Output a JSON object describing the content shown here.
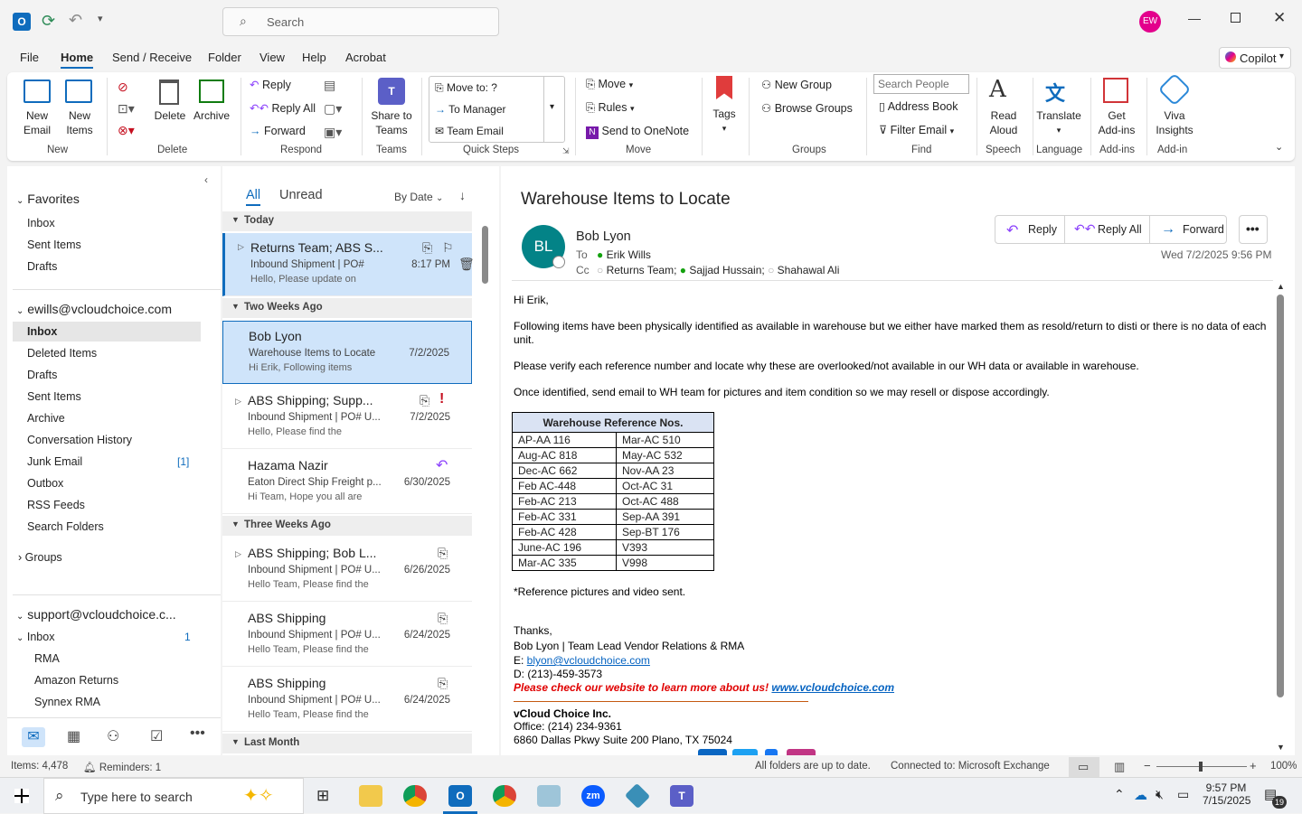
{
  "titlebar": {
    "search_placeholder": "Search",
    "avatar_initials": "EW"
  },
  "menu": {
    "items": [
      "File",
      "Home",
      "Send / Receive",
      "Folder",
      "View",
      "Help",
      "Acrobat"
    ],
    "active": "Home",
    "copilot": "Copilot"
  },
  "ribbon": {
    "new_email": [
      "New",
      "Email"
    ],
    "new_items": [
      "New",
      "Items"
    ],
    "delete": "Delete",
    "archive": "Archive",
    "reply": "Reply",
    "reply_all": "Reply All",
    "forward": "Forward",
    "share_teams": [
      "Share to",
      "Teams"
    ],
    "qs_move_to": "Move to: ?",
    "qs_to_manager": "To Manager",
    "qs_team_email": "Team Email",
    "move": "Move",
    "rules": "Rules",
    "send_onenote": "Send to OneNote",
    "tags": "Tags",
    "new_group": "New Group",
    "browse_groups": "Browse Groups",
    "search_people": "Search People",
    "address_book": "Address Book",
    "filter_email": "Filter Email",
    "read_aloud": [
      "Read",
      "Aloud"
    ],
    "translate": "Translate",
    "get_addins": [
      "Get",
      "Add-ins"
    ],
    "viva": [
      "Viva",
      "Insights"
    ],
    "groups": [
      "New",
      "Delete",
      "Respond",
      "Teams",
      "Quick Steps",
      "Move",
      "Groups",
      "Find",
      "Speech",
      "Language",
      "Add-ins",
      "Add-in"
    ]
  },
  "nav": {
    "favorites": "Favorites",
    "fav_items": [
      "Inbox",
      "Sent Items",
      "Drafts"
    ],
    "account1": "ewills@vcloudchoice.com",
    "acc1_items": [
      "Inbox",
      "Deleted Items",
      "Drafts",
      "Sent Items",
      "Archive",
      "Conversation History",
      "Junk Email",
      "Outbox",
      "RSS Feeds",
      "Search Folders"
    ],
    "junk_count": "[1]",
    "groups": "Groups",
    "account2": "support@vcloudchoice.c...",
    "acc2_inbox": "Inbox",
    "acc2_inbox_count": "1",
    "acc2_sub": [
      "RMA",
      "Amazon Returns",
      "Synnex RMA"
    ]
  },
  "list": {
    "tab_all": "All",
    "tab_unread": "Unread",
    "sort": "By Date",
    "groups": [
      "Today",
      "Two Weeks Ago",
      "Three Weeks Ago",
      "Last Month"
    ],
    "items": [
      {
        "sender": "Returns Team;  ABS S...",
        "subject": "Inbound Shipment | PO#",
        "preview": "Hello,  Please update on",
        "date": "8:17 PM"
      },
      {
        "sender": "Bob Lyon",
        "subject": "Warehouse Items to Locate",
        "preview": "Hi Erik,  Following items",
        "date": "7/2/2025"
      },
      {
        "sender": "ABS Shipping;  Supp...",
        "subject": "Inbound Shipment | PO# U...",
        "preview": "Hello,  Please find the",
        "date": "7/2/2025"
      },
      {
        "sender": "Hazama Nazir",
        "subject": "Eaton Direct Ship Freight p...",
        "preview": "Hi Team,  Hope you all are",
        "date": "6/30/2025"
      },
      {
        "sender": "ABS Shipping;  Bob L...",
        "subject": "Inbound Shipment | PO# U...",
        "preview": "Hello Team,  Please find the",
        "date": "6/26/2025"
      },
      {
        "sender": "ABS Shipping",
        "subject": "Inbound Shipment | PO# U...",
        "preview": "Hello Team,  Please find the",
        "date": "6/24/2025"
      },
      {
        "sender": "ABS Shipping",
        "subject": "Inbound Shipment | PO# U...",
        "preview": "Hello Team,  Please find the",
        "date": "6/24/2025"
      }
    ]
  },
  "reading": {
    "subject": "Warehouse Items to Locate",
    "initials": "BL",
    "sender": "Bob Lyon",
    "to_label": "To",
    "to": "Erik Wills",
    "cc_label": "Cc",
    "cc": [
      "Returns Team;",
      "Sajjad Hussain;",
      "Shahawal Ali"
    ],
    "reply": "Reply",
    "reply_all": "Reply All",
    "forward": "Forward",
    "date": "Wed 7/2/2025 9:56 PM",
    "greeting": "Hi Erik,",
    "p1": "Following items have been physically identified as available in warehouse but we either have marked them as resold/return to disti or there is no data of each unit.",
    "p2": "Please verify each reference number and locate why these are overlooked/not available in our WH data or available in warehouse.",
    "p3": "Once identified, send email to WH team for pictures and item condition so we may resell or dispose accordingly.",
    "table_header": "Warehouse Reference Nos.",
    "table_rows": [
      [
        "AP-AA 116",
        "Mar-AC 510"
      ],
      [
        "Aug-AC 818",
        "May-AC 532"
      ],
      [
        "Dec-AC 662",
        "Nov-AA 23"
      ],
      [
        "Feb AC-448",
        "Oct-AC 31"
      ],
      [
        "Feb-AC 213",
        "Oct-AC 488"
      ],
      [
        "Feb-AC 331",
        "Sep-AA 391"
      ],
      [
        "Feb-AC 428",
        "Sep-BT 176"
      ],
      [
        "June-AC 196",
        "V393"
      ],
      [
        "Mar-AC 335",
        "V998"
      ]
    ],
    "note": "*Reference pictures and video sent.",
    "thanks": "Thanks,",
    "sig_name": "Bob Lyon | Team Lead Vendor Relations & RMA",
    "sig_email_label": "E: ",
    "sig_email": "blyon@vcloudchoice.com",
    "sig_phone": "D: (213)-459-3573",
    "promo": "Please check our website to learn more about us! ",
    "promo_link": "www.vcloudchoice.com",
    "company": "vCloud Choice Inc.",
    "office": "Office: (214) 234-9361",
    "address": "6860 Dallas Pkwy Suite 200 Plano, TX 75024"
  },
  "status": {
    "items": "Items: 4,478",
    "reminders": "Reminders: 1",
    "sync": "All folders are up to date.",
    "connection": "Connected to: Microsoft Exchange",
    "zoom": "100%"
  },
  "taskbar": {
    "search": "Type here to search",
    "time": "9:57 PM",
    "date": "7/15/2025",
    "notif": "19"
  }
}
